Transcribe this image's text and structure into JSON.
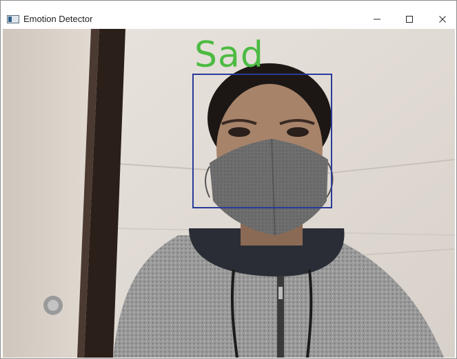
{
  "window": {
    "title": "Emotion Detector",
    "controls": {
      "minimize": "–",
      "maximize": "☐",
      "close": "✕"
    }
  },
  "detection": {
    "label": "Sad",
    "label_color": "#4cbb42",
    "box_color": "#2a3a9a"
  },
  "icons": [
    "window-app-icon",
    "minimize-icon",
    "maximize-icon",
    "close-icon"
  ]
}
